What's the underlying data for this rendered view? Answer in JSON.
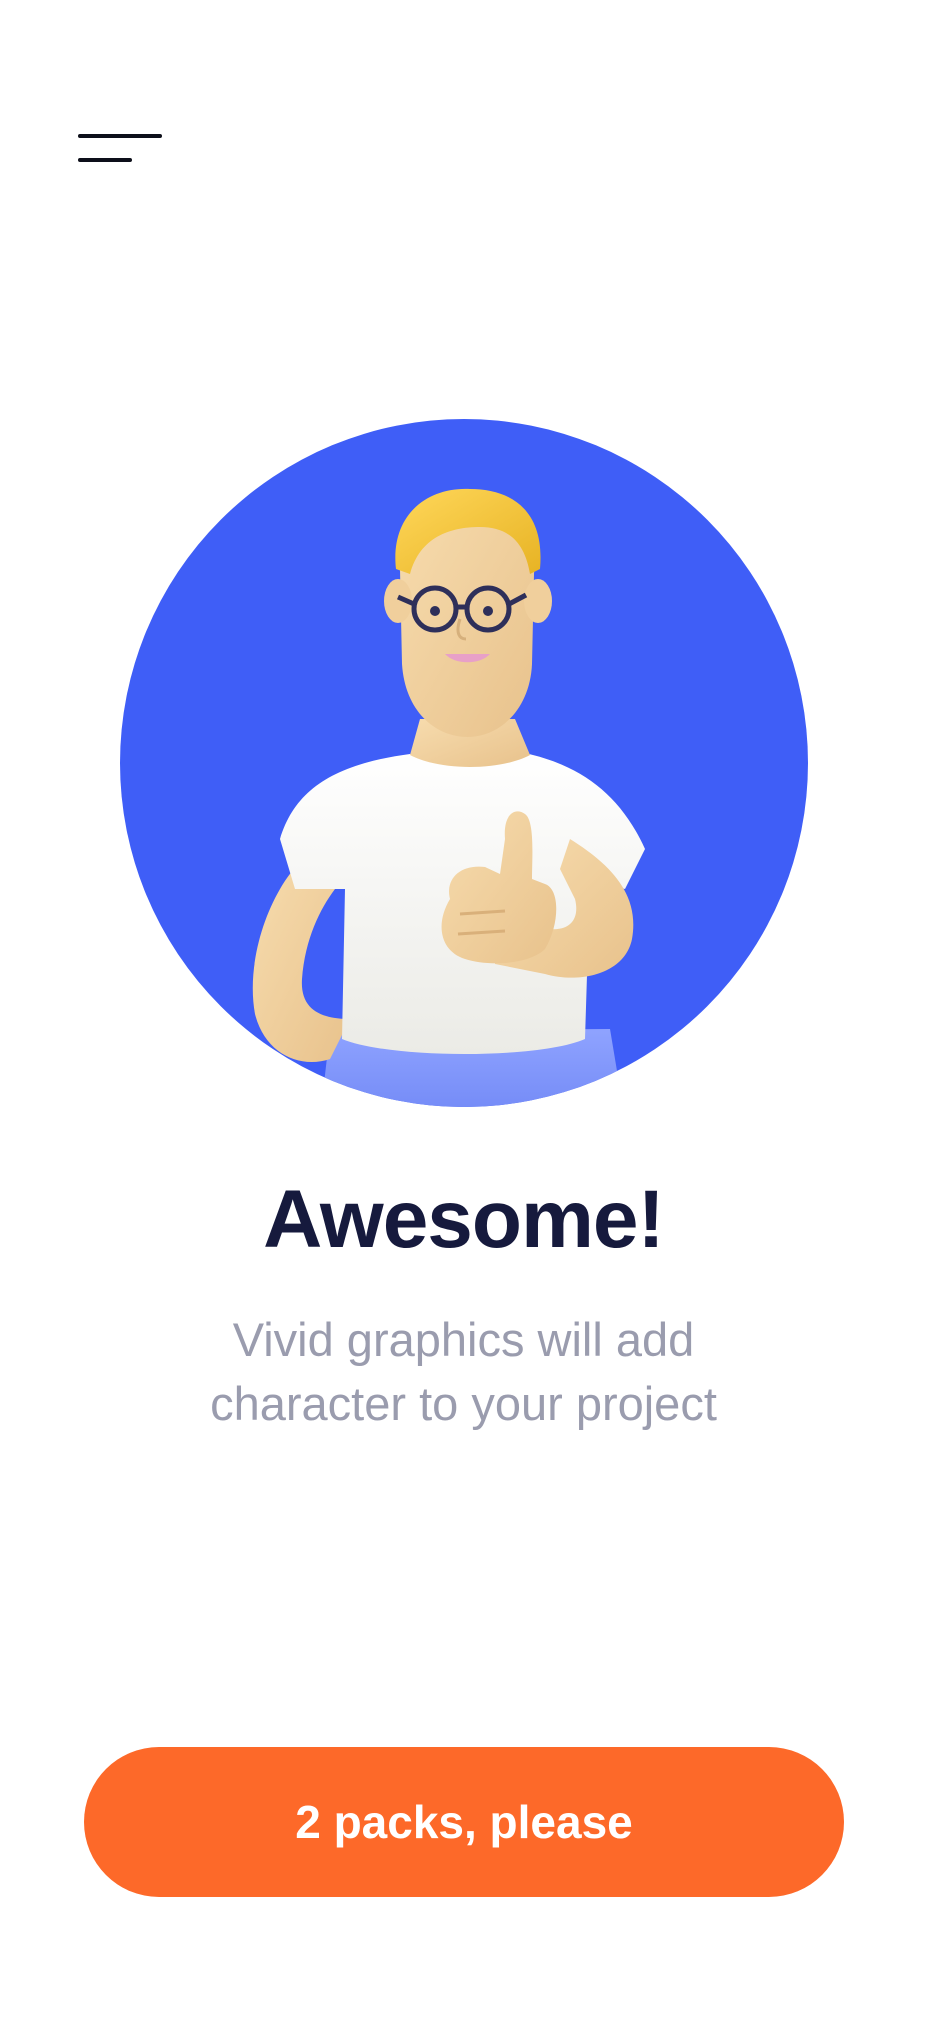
{
  "header": {
    "menu_icon": "hamburger-menu-icon"
  },
  "illustration": {
    "subject": "3d-character-thumbs-up-illustration",
    "circle_color": "#3f5ef7"
  },
  "content": {
    "title": "Awesome!",
    "subtitle": "Vivid graphics will add character to your project"
  },
  "cta": {
    "label": "2 packs, please",
    "color": "#fd6929"
  }
}
